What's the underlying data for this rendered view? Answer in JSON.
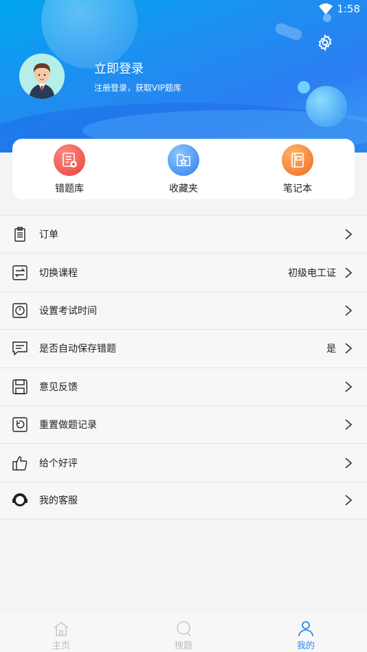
{
  "status_bar": {
    "time": "1:58"
  },
  "header": {
    "login_title": "立即登录",
    "login_subtitle": "注册登录，获取VIP题库"
  },
  "quick_actions": [
    {
      "label": "错题库",
      "icon": "wrong-questions-icon",
      "color": "#f0524d"
    },
    {
      "label": "收藏夹",
      "icon": "favorites-folder-icon",
      "color": "#3a8ef0"
    },
    {
      "label": "笔记本",
      "icon": "notebook-icon",
      "color": "#f57a2a"
    }
  ],
  "menu": [
    {
      "label": "订单",
      "value": "",
      "icon": "clipboard-icon"
    },
    {
      "label": "切换课程",
      "value": "初级电工证",
      "icon": "switch-icon"
    },
    {
      "label": "设置考试时间",
      "value": "",
      "icon": "timer-icon"
    },
    {
      "label": "是否自动保存错题",
      "value": "是",
      "icon": "chat-icon"
    },
    {
      "label": "意见反馈",
      "value": "",
      "icon": "save-icon"
    },
    {
      "label": "重置做题记录",
      "value": "",
      "icon": "reset-icon"
    },
    {
      "label": "给个好评",
      "value": "",
      "icon": "thumbs-up-icon"
    },
    {
      "label": "我的客服",
      "value": "",
      "icon": "headset-icon"
    }
  ],
  "bottom_nav": [
    {
      "label": "主页",
      "icon": "home-icon",
      "active": false
    },
    {
      "label": "搜题",
      "icon": "search-icon",
      "active": false
    },
    {
      "label": "我的",
      "icon": "person-icon",
      "active": true
    }
  ],
  "colors": {
    "accent": "#2f86ee",
    "header_blue": "#1e8ef0"
  }
}
